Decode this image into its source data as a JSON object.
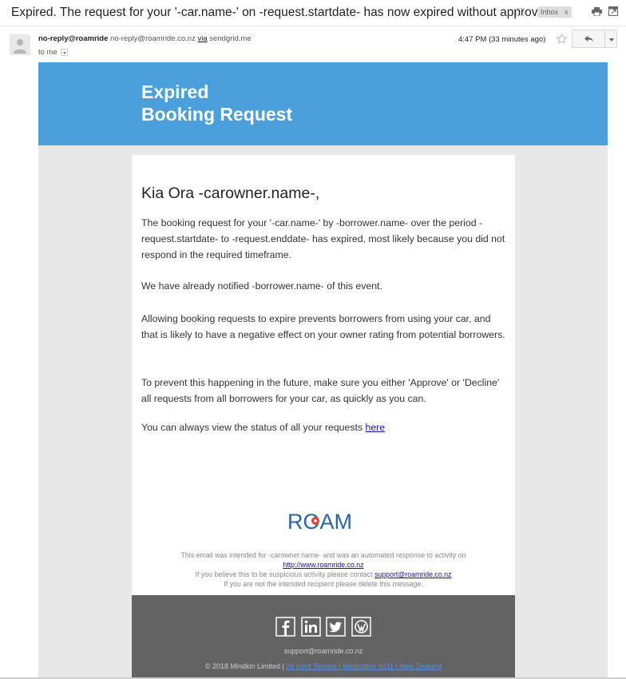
{
  "thread": {
    "subject": "Expired. The request for your '-car.name-' on -request.startdate- has now expired without approval.",
    "label": "Inbox",
    "label_close": "x"
  },
  "message": {
    "sender_name": "no-reply@roamride",
    "sender_email": "no-reply@roamride.co.nz",
    "via_label": "via",
    "via_domain": "sendgrid.me",
    "to_label": "to me",
    "time": "4:47 PM (33 minutes ago)"
  },
  "email": {
    "header_line1": "Expired",
    "header_line2": "Booking Request",
    "greeting": "Kia Ora -carowner.name-,",
    "paragraphs": [
      "The booking request for your '-car.name-' by -borrower.name- over the period -request.startdate- to -request.enddate- has expired, most likely because you did not respond in the required timeframe.",
      "We have already notified -borrower.name- of this event.",
      "Allowing booking requests to expire prevents borrowers from using your car, and that is likely to have a negative effect on your owner rating from potential borrowers.",
      "To prevent this happening in the future, make sure you either 'Approve' or 'Decline' all requests from all borrowers for your car, as quickly as you can."
    ],
    "status_text": "You can always view the status of all your requests",
    "status_link": "here",
    "logo_text": "ROAM",
    "fine1": "This email was intended for -carowner.name- and was an automated response to activity on",
    "fine1_link": "http://www.roamride.co.nz",
    "fine2": "If you believe this to be suspicious activity please contact",
    "fine2_link": "support@roamride.co.nz",
    "fine3": "If you are not the intended recipient please delete this message.",
    "footer_email": "support@roamride.co.nz",
    "footer_copy": "© 2018 Mindkin Limited |",
    "footer_address": "26 Kent Terrace | Wellington 6011 | New Zealand"
  },
  "colors": {
    "header_blue": "#4ba0dc",
    "footer_gray": "#636363",
    "logo_blue": "#2a64a8",
    "logo_red": "#e0443e"
  },
  "icons": [
    "print-icon",
    "new-window-icon",
    "star-icon",
    "reply-icon",
    "facebook-icon",
    "linkedin-icon",
    "twitter-icon",
    "wordpress-icon"
  ]
}
